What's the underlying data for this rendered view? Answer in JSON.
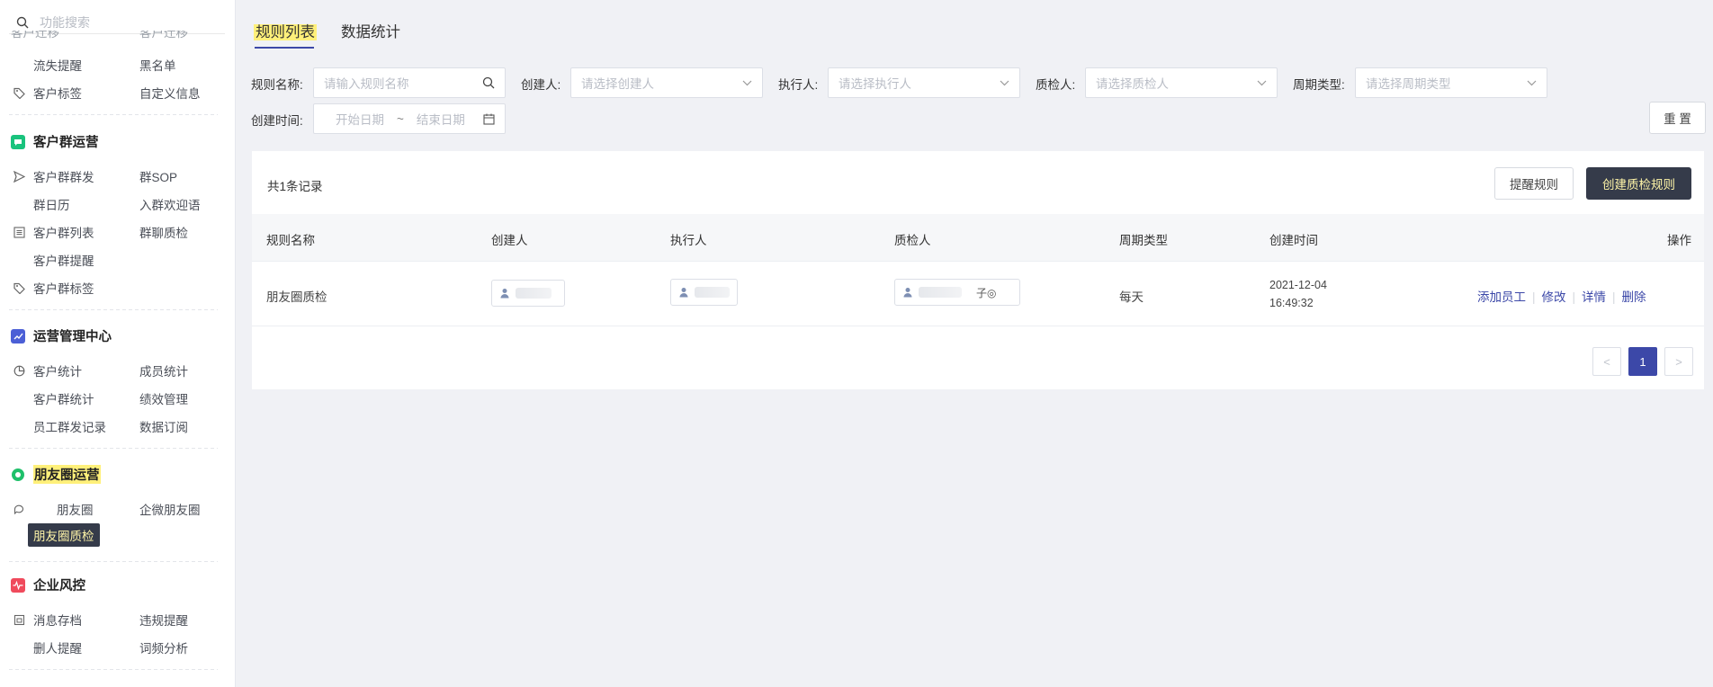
{
  "sidebar": {
    "search_placeholder": "功能搜索",
    "top_cut_items": [
      "客户迁移",
      "客户迁移"
    ],
    "items_a": [
      {
        "label": "流失提醒",
        "icon": "none"
      },
      {
        "label": "黑名单",
        "icon": "none"
      },
      {
        "label": "客户标签",
        "icon": "tag-icon"
      },
      {
        "label": "自定义信息",
        "icon": "none"
      }
    ],
    "section_group": {
      "title": "客户群运营",
      "items": [
        {
          "label": "客户群群发",
          "icon": "send-icon"
        },
        {
          "label": "群SOP",
          "icon": "none"
        },
        {
          "label": "群日历",
          "icon": "none"
        },
        {
          "label": "入群欢迎语",
          "icon": "none"
        },
        {
          "label": "客户群列表",
          "icon": "list-icon"
        },
        {
          "label": "群聊质检",
          "icon": "none"
        },
        {
          "label": "客户群提醒",
          "icon": "none"
        },
        {
          "label": "客户群标签",
          "icon": "tag-icon"
        }
      ]
    },
    "section_ops": {
      "title": "运营管理中心",
      "items": [
        {
          "label": "客户统计",
          "icon": "pie-icon"
        },
        {
          "label": "成员统计",
          "icon": "none"
        },
        {
          "label": "客户群统计",
          "icon": "none"
        },
        {
          "label": "绩效管理",
          "icon": "none"
        },
        {
          "label": "员工群发记录",
          "icon": "none"
        },
        {
          "label": "数据订阅",
          "icon": "none"
        }
      ]
    },
    "section_moments": {
      "title": "朋友圈运营",
      "items": [
        {
          "label": "朋友圈",
          "icon": "chat-icon"
        },
        {
          "label": "企微朋友圈",
          "icon": "none"
        },
        {
          "label": "朋友圈质检",
          "icon": "none"
        }
      ]
    },
    "section_risk": {
      "title": "企业风控",
      "items": [
        {
          "label": "消息存档",
          "icon": "archive-icon"
        },
        {
          "label": "违规提醒",
          "icon": "none"
        },
        {
          "label": "删人提醒",
          "icon": "none"
        },
        {
          "label": "词频分析",
          "icon": "none"
        }
      ]
    }
  },
  "tabs": [
    {
      "label": "规则列表",
      "active": true
    },
    {
      "label": "数据统计",
      "active": false
    }
  ],
  "filters": {
    "rule_name": {
      "label": "规则名称:",
      "placeholder": "请输入规则名称"
    },
    "creator": {
      "label": "创建人:",
      "placeholder": "请选择创建人"
    },
    "executor": {
      "label": "执行人:",
      "placeholder": "请选择执行人"
    },
    "inspector": {
      "label": "质检人:",
      "placeholder": "请选择质检人"
    },
    "cycle": {
      "label": "周期类型:",
      "placeholder": "请选择周期类型"
    },
    "created_time": {
      "label": "创建时间:",
      "start": "开始日期",
      "sep": "~",
      "end": "结束日期"
    },
    "reset_label": "重 置"
  },
  "table": {
    "record_count": "共1条记录",
    "remind_rules_label": "提醒规则",
    "create_rule_label": "创建质检规则",
    "columns": [
      "规则名称",
      "创建人",
      "执行人",
      "质检人",
      "周期类型",
      "创建时间",
      "操作"
    ],
    "rows": [
      {
        "name": "朋友圈质检",
        "creator": "",
        "executor": "",
        "inspector_fragment": "子◎",
        "cycle": "每天",
        "created_date": "2021-12-04",
        "created_time": "16:49:32",
        "actions": [
          "添加员工",
          "修改",
          "详情",
          "删除"
        ]
      }
    ]
  },
  "pager": {
    "prev": "<",
    "current": "1",
    "next": ">"
  },
  "colors": {
    "accent": "#3c48a8",
    "dark_button": "#353b4a",
    "highlight": "#fff07a",
    "group_icon": "#19c37d",
    "ops_icon": "#4b5fd6",
    "moments_icon": "#1fc06a",
    "risk_icon": "#f04a5c"
  }
}
